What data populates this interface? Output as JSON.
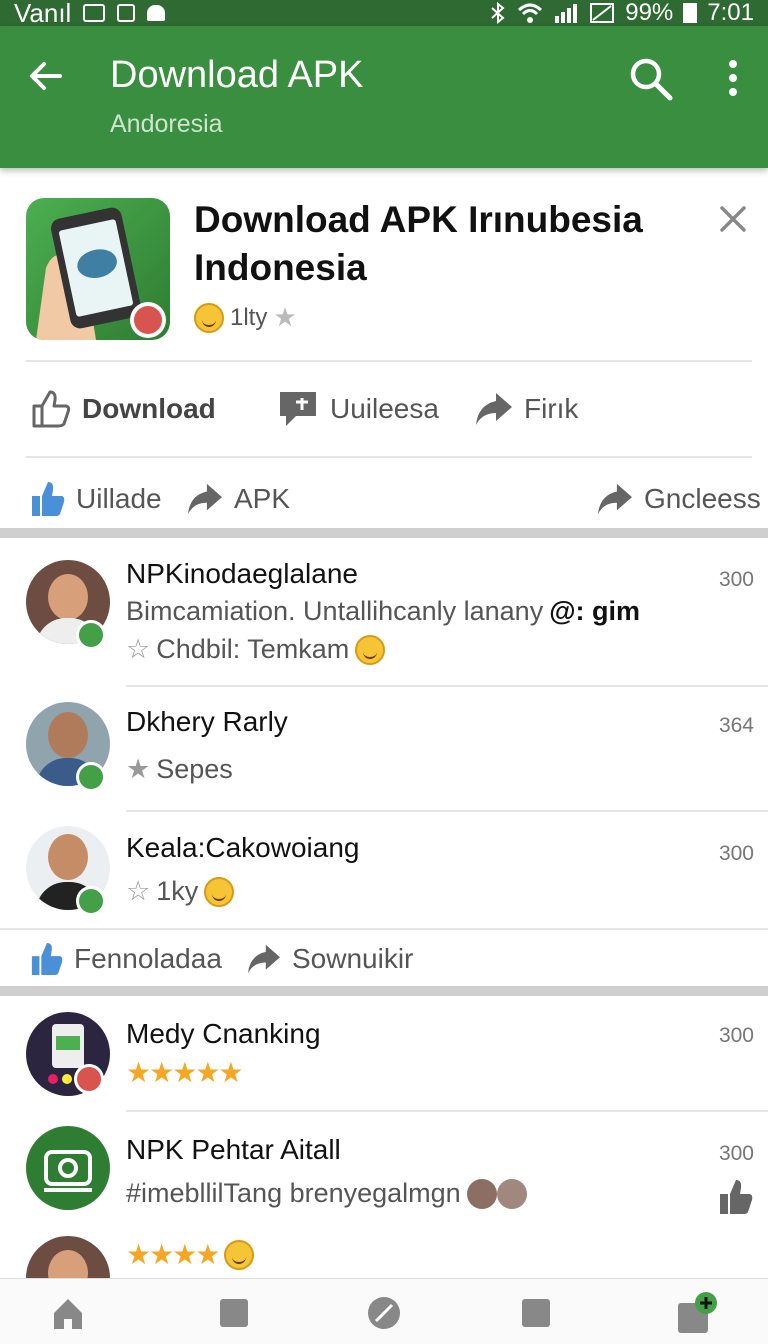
{
  "status_bar": {
    "carrier": "Vanıl",
    "battery": "99%",
    "time": "7:01"
  },
  "app_bar": {
    "title": "Download APK",
    "subtitle": "Andoresia"
  },
  "app_card": {
    "title": "Download APK Irınubesia Indonesia",
    "rating_text": "1lty",
    "actions": [
      {
        "label": "Download",
        "icon": "thumbs-up-outline-icon"
      },
      {
        "label": "Uuileesa",
        "icon": "chat-bubble-icon"
      },
      {
        "label": "Firık",
        "icon": "share-arrow-icon"
      }
    ],
    "subactions": [
      {
        "label": "Uillade",
        "icon": "thumbs-up-icon"
      },
      {
        "label": "APK",
        "icon": "share-arrow-icon"
      },
      {
        "label": "Gncleess",
        "icon": "share-arrow-icon"
      }
    ]
  },
  "section1": {
    "items": [
      {
        "name": "NPKinodaeglalane",
        "line1": "Bimcamiation. Untallihcanly lanany",
        "line1_bold": "@: gim",
        "line2": "Chdbil: Temkam",
        "count": "300"
      },
      {
        "name": "Dkhery Rarly",
        "line2": "Sepes",
        "count": "364"
      },
      {
        "name": "Keala:Cakowoiang",
        "line2": "1ky",
        "count": "300"
      }
    ],
    "footer_actions": [
      {
        "label": "Fennoladaa",
        "icon": "thumbs-up-icon"
      },
      {
        "label": "Sownuikir",
        "icon": "share-arrow-icon"
      }
    ]
  },
  "section2": {
    "items": [
      {
        "name": "Medy Cnanking",
        "stars": "★★★★★",
        "count": "300"
      },
      {
        "name": "NPK Pehtar Aitall",
        "line1": "#imebllilTang brenyegalmgn",
        "count": "300"
      },
      {
        "stars": "★★★★"
      }
    ]
  },
  "colors": {
    "app_bar": "#3a8e3f",
    "status_bar": "#2e6a31",
    "accent_blue": "#4a90d9",
    "star": "#f5a623",
    "badge_green": "#43a047"
  }
}
